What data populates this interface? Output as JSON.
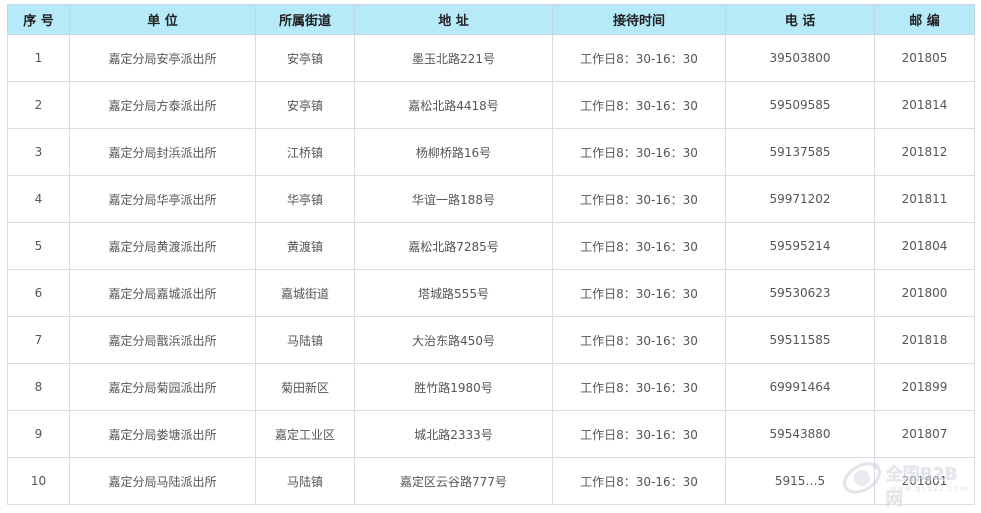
{
  "headers": [
    "序 号",
    "单 位",
    "所属街道",
    "地 址",
    "接待时间",
    "电 话",
    "邮 编"
  ],
  "rows": [
    [
      "1",
      "嘉定分局安亭派出所",
      "安亭镇",
      "墨玉北路221号",
      "工作日8：30-16：30",
      "39503800",
      "201805"
    ],
    [
      "2",
      "嘉定分局方泰派出所",
      "安亭镇",
      "嘉松北路4418号",
      "工作日8：30-16：30",
      "59509585",
      "201814"
    ],
    [
      "3",
      "嘉定分局封浜派出所",
      "江桥镇",
      "杨柳桥路16号",
      "工作日8：30-16：30",
      "59137585",
      "201812"
    ],
    [
      "4",
      "嘉定分局华亭派出所",
      "华亭镇",
      "华谊一路188号",
      "工作日8：30-16：30",
      "59971202",
      "201811"
    ],
    [
      "5",
      "嘉定分局黄渡派出所",
      "黄渡镇",
      "嘉松北路7285号",
      "工作日8：30-16：30",
      "59595214",
      "201804"
    ],
    [
      "6",
      "嘉定分局嘉城派出所",
      "嘉城街道",
      "塔城路555号",
      "工作日8：30-16：30",
      "59530623",
      "201800"
    ],
    [
      "7",
      "嘉定分局戬浜派出所",
      "马陆镇",
      "大治东路450号",
      "工作日8：30-16：30",
      "59511585",
      "201818"
    ],
    [
      "8",
      "嘉定分局菊园派出所",
      "菊田新区",
      "胜竹路1980号",
      "工作日8：30-16：30",
      "69991464",
      "201899"
    ],
    [
      "9",
      "嘉定分局娄塘派出所",
      "嘉定工业区",
      "城北路2333号",
      "工作日8：30-16：30",
      "59543880",
      "201807"
    ],
    [
      "10",
      "嘉定分局马陆派出所",
      "马陆镇",
      "嘉定区云谷路777号",
      "工作日8：30-16：30",
      "5915…5",
      "201801"
    ]
  ],
  "watermark": {
    "text": "全国B2B网",
    "url": "www.qs522.com",
    "icon": "b2b-logo-icon"
  }
}
